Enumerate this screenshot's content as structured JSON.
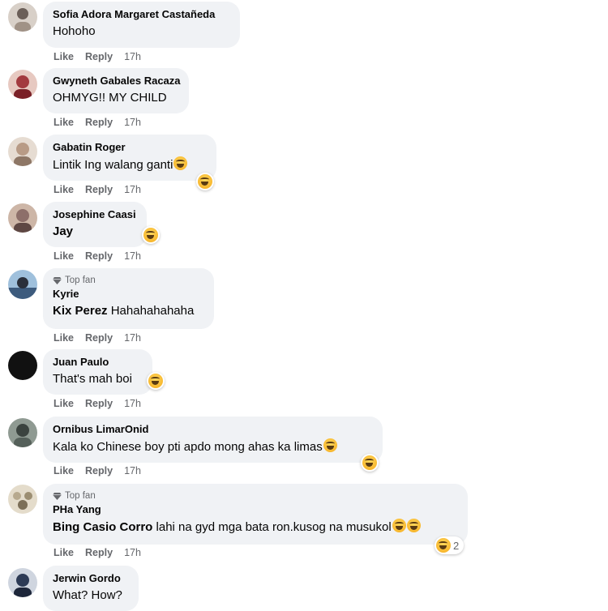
{
  "actions": {
    "like": "Like",
    "reply": "Reply"
  },
  "comments": [
    {
      "author": "Sofia Adora Margaret Castañeda",
      "text": "Hohoho",
      "time": "17h",
      "avatar_color": "#d8d0c8"
    },
    {
      "author": "Gwyneth Gabales Racaza",
      "text": "OHMYG!! MY CHILD",
      "time": "17h",
      "avatar_color": "#a33a3f"
    },
    {
      "author": "Gabatin Roger",
      "text": "Lintik Ing walang ganti",
      "time": "17h",
      "avatar_color": "#b89b86"
    },
    {
      "author": "Josephine Caasi",
      "text": "Jay",
      "time": "17h",
      "avatar_color": "#8d6f6a"
    },
    {
      "badge": "Top fan",
      "author": "Kyrie",
      "mention": "Kix Perez",
      "text": "Hahahahahaha",
      "time": "17h",
      "avatar_color": "#4c6e95"
    },
    {
      "author": "Juan Paulo",
      "text": "That's mah boi",
      "time": "17h",
      "avatar_color": "#111111"
    },
    {
      "author": "Ornibus LimarOnid",
      "text": "Kala ko Chinese boy pti apdo mong ahas ka limas",
      "time": "17h",
      "avatar_color": "#55605a"
    },
    {
      "badge": "Top fan",
      "author": "PHa Yang",
      "mention": "Bing Casio Corro",
      "text": "lahi na gyd mga bata ron.kusog na musukol",
      "time": "17h",
      "reaction_count": "2",
      "avatar_color": "#b7a98e"
    },
    {
      "author": "Jerwin Gordo",
      "text": "What? How?",
      "avatar_color": "#2c3a55"
    }
  ]
}
